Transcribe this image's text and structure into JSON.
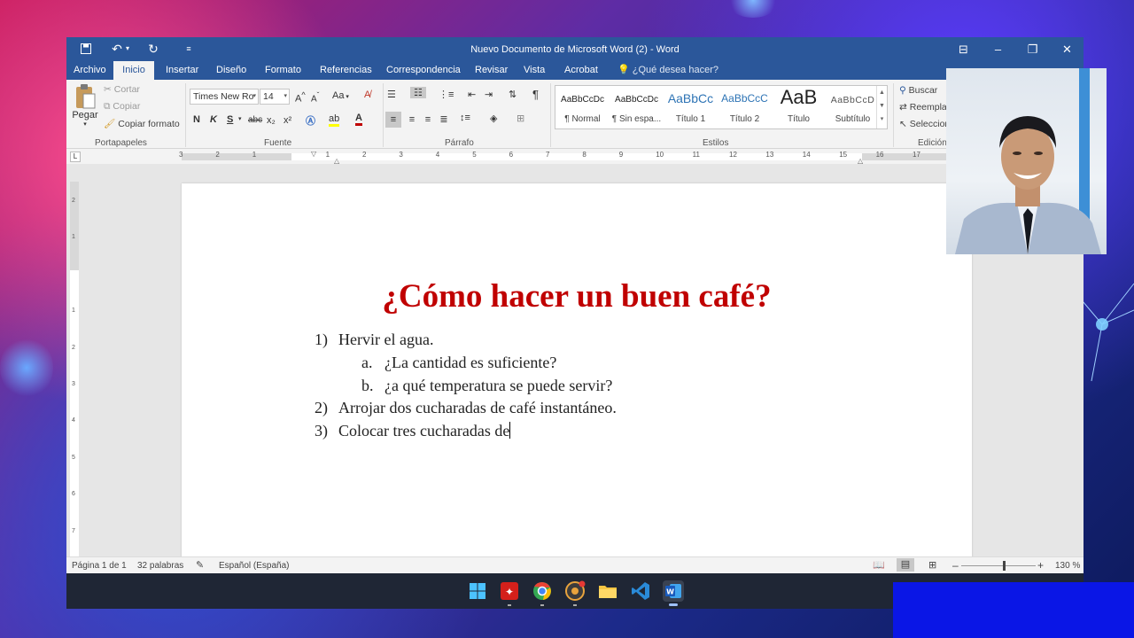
{
  "window": {
    "title": "Nuevo Documento de Microsoft Word (2) - Word",
    "quick_access": {
      "save": "save-icon",
      "undo": "undo-icon",
      "redo": "redo-icon",
      "customize": "customize-icon"
    },
    "controls": {
      "ribbon_options": "ribbon-display-icon",
      "minimize": "–",
      "restore": "❐",
      "close": "✕"
    }
  },
  "tabs": [
    {
      "label": "Archivo"
    },
    {
      "label": "Inicio",
      "active": true
    },
    {
      "label": "Insertar"
    },
    {
      "label": "Diseño"
    },
    {
      "label": "Formato"
    },
    {
      "label": "Referencias"
    },
    {
      "label": "Correspondencia"
    },
    {
      "label": "Revisar"
    },
    {
      "label": "Vista"
    },
    {
      "label": "Acrobat"
    }
  ],
  "tell_me": "¿Qué desea hacer?",
  "ribbon": {
    "clipboard": {
      "paste": "Pegar",
      "cut": "Cortar",
      "copy": "Copiar",
      "format_painter": "Copiar formato",
      "label": "Portapapeles"
    },
    "font": {
      "name": "Times New Ro",
      "size": "14",
      "label": "Fuente",
      "bold": "N",
      "italic": "K",
      "underline": "S",
      "strike": "abc",
      "subscript": "x₂",
      "superscript": "x²",
      "case": "Aa"
    },
    "paragraph": {
      "label": "Párrafo",
      "pilcrow": "¶"
    },
    "styles": {
      "label": "Estilos",
      "items": [
        {
          "preview": "AaBbCcDc",
          "name": "¶ Normal"
        },
        {
          "preview": "AaBbCcDc",
          "name": "¶ Sin espa..."
        },
        {
          "preview": "AaBbCc",
          "name": "Título 1"
        },
        {
          "preview": "AaBbCcC",
          "name": "Título 2"
        },
        {
          "preview": "AaB",
          "name": "Título"
        },
        {
          "preview": "AaBbCcD",
          "name": "Subtítulo"
        }
      ]
    },
    "editing": {
      "find": "Buscar",
      "replace": "Reemplazar",
      "select": "Seleccionar",
      "label": "Edición"
    }
  },
  "ruler": {
    "hlabels": [
      "3",
      "2",
      "1",
      "1",
      "2",
      "3",
      "4",
      "5",
      "6",
      "7",
      "8",
      "9",
      "10",
      "11",
      "12",
      "13",
      "14",
      "15",
      "16",
      "17"
    ],
    "vlabels": [
      "2",
      "1",
      "1",
      "2",
      "3",
      "4",
      "5",
      "6",
      "7"
    ]
  },
  "document": {
    "title": "¿Cómo hacer un buen café?",
    "items": [
      {
        "marker": "1)",
        "text": "Hervir el agua."
      },
      {
        "marker": "a.",
        "text": "¿La cantidad es suficiente?"
      },
      {
        "marker": "b.",
        "text": "¿a qué temperatura se puede servir?"
      },
      {
        "marker": "2)",
        "text": "Arrojar dos cucharadas de café instantáneo."
      },
      {
        "marker": "3)",
        "text": "Colocar tres cucharadas de"
      }
    ]
  },
  "status": {
    "page": "Página 1 de 1",
    "words": "32 palabras",
    "language": "Español (España)",
    "zoom": "130 %",
    "zoom_minus": "–",
    "zoom_plus": "+",
    "zoom_level_percent": 130
  },
  "taskbar": {
    "icons": [
      "windows-start-icon",
      "acrobat-icon",
      "chrome-icon",
      "chrome-canary-icon",
      "file-explorer-icon",
      "vscode-icon",
      "word-icon"
    ]
  }
}
